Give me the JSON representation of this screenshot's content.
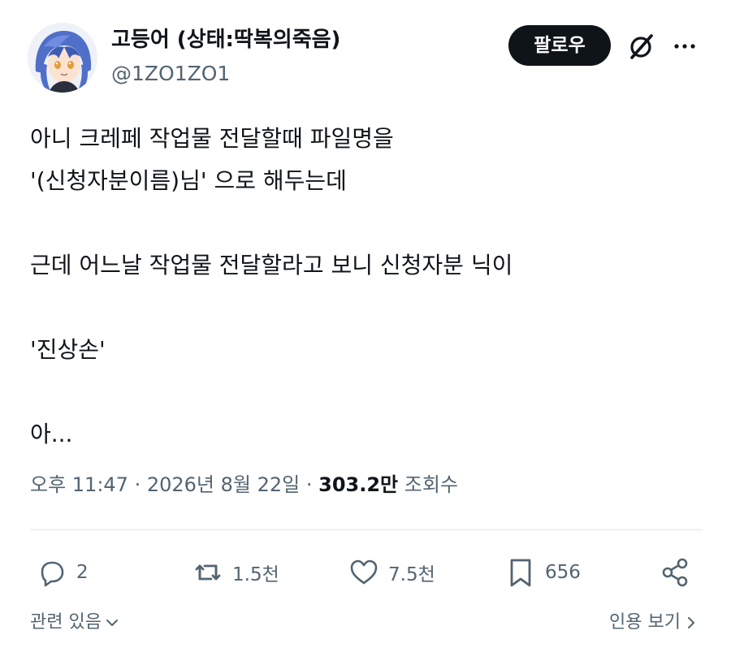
{
  "author": {
    "display_name": "고등어 (상태:딱복의죽음)",
    "handle": "@1ZO1ZO1",
    "avatar_icon": "anime-character-avatar-icon"
  },
  "header": {
    "follow_label": "팔로우",
    "grok_icon": "grok-slash-circle-icon",
    "more_icon": "more-dots-icon"
  },
  "tweet": {
    "lines": [
      "아니 크레페 작업물 전달할때 파일명을",
      "'(신청자분이름)님' 으로 해두는데",
      "",
      "근데 어느날 작업물 전달할라고 보니 신청자분 닉이",
      "",
      "'진상손'",
      "",
      "아..."
    ]
  },
  "meta": {
    "time": "오후 11:47",
    "sep1": " · ",
    "date": "2026년 8월 22일",
    "sep2": " · ",
    "views_count": "303.2만",
    "views_label": " 조회수"
  },
  "actions": {
    "replies": "2",
    "reposts": "1.5천",
    "likes": "7.5천",
    "bookmarks": "656"
  },
  "footer": {
    "related_label": "관련 있음",
    "quotes_label": "인용 보기"
  },
  "colors": {
    "text": "#0f1419",
    "secondary": "#536471",
    "follow_bg": "#0f1419",
    "divider": "#e1e6ea"
  }
}
